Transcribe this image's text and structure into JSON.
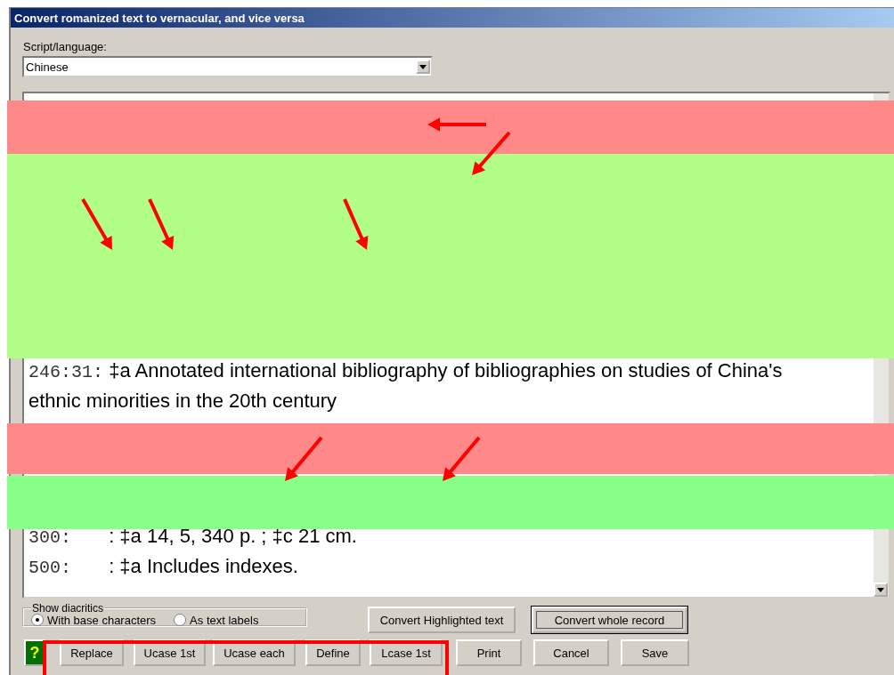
{
  "window": {
    "title": "Convert romanized text to vernacular, and vice versa"
  },
  "script_language": {
    "label": "Script/language:",
    "value": "Chinese"
  },
  "record_lines": [
    {
      "tag": "246:31:",
      "text": "‡a Annotated international bibliography of bibliographies on studies of China's ethnic minorities in the 20th century"
    },
    {
      "tag": "300:",
      "text": ": ‡a 14, 5, 340 p. ; ‡c 21 cm."
    },
    {
      "tag": "500:",
      "text": ": ‡a Includes indexes."
    }
  ],
  "diacritics": {
    "label": "Show diacritics",
    "options": [
      {
        "label": "With base characters",
        "selected": true
      },
      {
        "label": "As text labels",
        "selected": false
      }
    ]
  },
  "convert_buttons": [
    {
      "label": "Convert Highlighted text",
      "focused": false
    },
    {
      "label": "Convert whole record",
      "focused": true
    }
  ],
  "help_button": "?",
  "buttons": [
    "Replace",
    "Ucase 1st",
    "Ucase each",
    "Define",
    "Lcase 1st",
    "Print",
    "Cancel",
    "Save"
  ]
}
